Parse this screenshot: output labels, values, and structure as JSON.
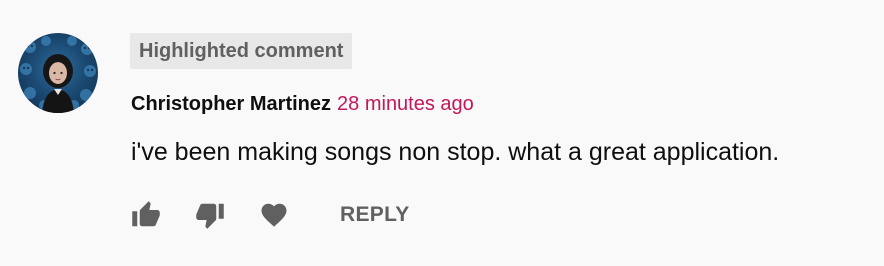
{
  "comment": {
    "badge": "Highlighted comment",
    "author": "Christopher Martinez",
    "timestamp": "28 minutes ago",
    "text": "i've been making songs non stop. what a great application.",
    "avatar": "user-avatar",
    "actions": {
      "like_icon": "thumbs-up-icon",
      "dislike_icon": "thumbs-down-icon",
      "heart_icon": "heart-icon",
      "reply_label": "REPLY"
    }
  },
  "colors": {
    "background": "#f9f9f9",
    "badge_bg": "#e8e8e8",
    "badge_text": "#606060",
    "author_text": "#0f0f0f",
    "timestamp_text": "#c2185b",
    "icon": "#606060"
  }
}
